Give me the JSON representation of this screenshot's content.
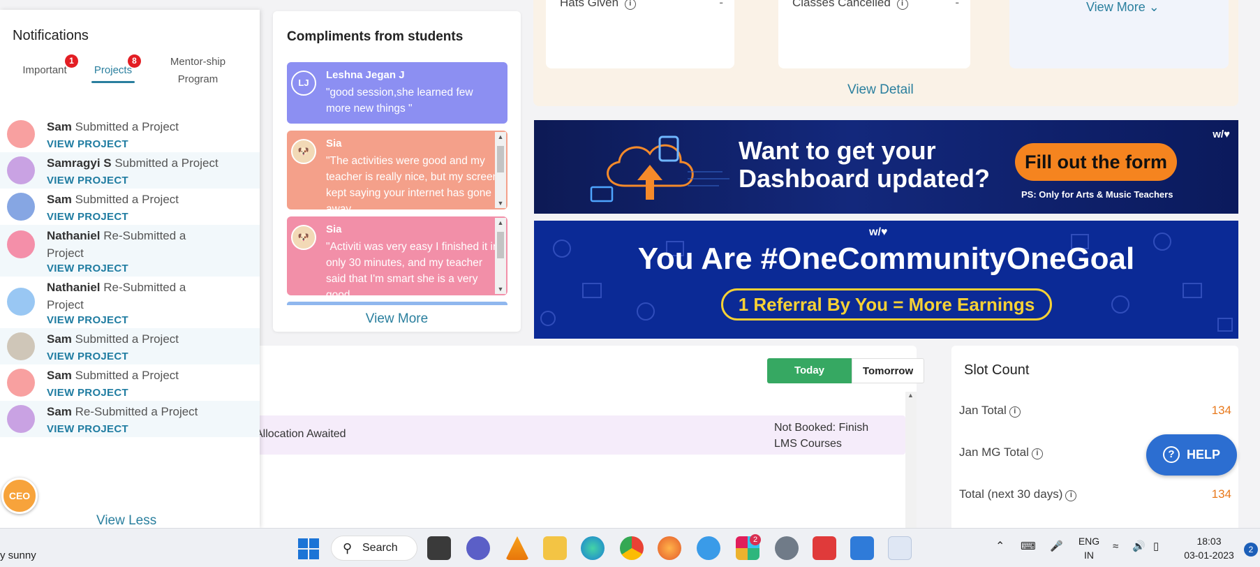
{
  "notifications": {
    "title": "Notifications",
    "tabs": [
      {
        "label": "Important",
        "badge": "1"
      },
      {
        "label": "Projects",
        "badge": "8"
      },
      {
        "label": "Mentor-ship Program",
        "badge": ""
      }
    ],
    "items": [
      {
        "name": "Sam",
        "action": "Submitted a Project",
        "link": "VIEW PROJECT",
        "color": "#f8a0a0"
      },
      {
        "name": "Samragyi S",
        "action": "Submitted a Project",
        "link": "VIEW PROJECT",
        "color": "#c9a2e3"
      },
      {
        "name": "Sam",
        "action": "Submitted a Project",
        "link": "VIEW PROJECT",
        "color": "#86a6e3"
      },
      {
        "name": "Nathaniel",
        "action": "Re-Submitted a Project",
        "link": "VIEW PROJECT",
        "color": "#f48fa9"
      },
      {
        "name": "Nathaniel",
        "action": "Re-Submitted a Project",
        "link": "VIEW PROJECT",
        "color": "#99c7f3"
      },
      {
        "name": "Sam",
        "action": "Submitted a Project",
        "link": "VIEW PROJECT",
        "color": "#cfc6b8"
      },
      {
        "name": "Sam",
        "action": "Submitted a Project",
        "link": "VIEW PROJECT",
        "color": "#f8a0a0"
      },
      {
        "name": "Sam",
        "action": "Re-Submitted a Project",
        "link": "VIEW PROJECT",
        "color": "#c9a2e3"
      }
    ],
    "view_less": "View Less",
    "ceo_badge": "CEO"
  },
  "compliments": {
    "title": "Compliments from students",
    "items": [
      {
        "initials": "LJ",
        "name": "Leshna Jegan J",
        "message": "\"good session,she learned few more new things \"",
        "color": "#8c8ff2"
      },
      {
        "initials": "",
        "name": "Sia",
        "message": "\"The activities were good and my teacher is really nice, but my screen kept saying your internet has gone away",
        "color": "#f4a08a"
      },
      {
        "initials": "",
        "name": "Sia",
        "message": "\"Activiti was very easy I finished it in only 30 minutes, and my teacher said that I'm smart she is a very good",
        "color": "#f28fa8"
      }
    ],
    "view_more": "View More"
  },
  "stats": {
    "boxes": [
      {
        "label": "Hats Given",
        "value": "-"
      },
      {
        "label": "Classes Cancelled",
        "value": "-"
      }
    ],
    "view_more": "View More",
    "view_detail": "View Detail"
  },
  "banner_dashboard": {
    "headline_1": "Want to get your",
    "headline_2": "Dashboard updated?",
    "button": "Fill out the form",
    "note": "PS: Only for Arts & Music Teachers",
    "logo": "w/♥"
  },
  "banner_community": {
    "headline": "You Are #OneCommunityOneGoal",
    "pill": "1 Referral By You = More Earnings",
    "logo": "w/♥"
  },
  "schedule": {
    "today": "Today",
    "tomorrow": "Tomorrow",
    "row_status": "Allocation Awaited",
    "row_note": "Not Booked: Finish LMS Courses"
  },
  "slot_count": {
    "title": "Slot Count",
    "rows": [
      {
        "label": "Jan Total",
        "value": "134"
      },
      {
        "label": "Jan MG Total",
        "value": ""
      },
      {
        "label": "Total (next 30 days)",
        "value": "134"
      }
    ]
  },
  "help": {
    "label": "HELP"
  },
  "taskbar": {
    "weather": "y sunny",
    "search": "Search",
    "lang_1": "ENG",
    "lang_2": "IN",
    "time": "18:03",
    "date": "03-01-2023",
    "notif_count": "2",
    "slack_badge": "2"
  },
  "colors": {
    "accent": "#2a7f9e",
    "today_green": "#36a862",
    "slot_orange": "#e8791c",
    "help_blue": "#2c6ed1"
  }
}
